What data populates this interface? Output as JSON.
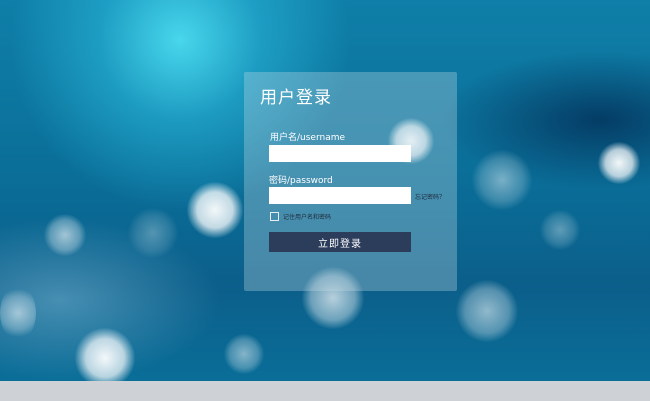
{
  "login": {
    "title": "用户登录",
    "username_label": "用户名/username",
    "username_value": "",
    "password_label": "密码/password",
    "password_value": "",
    "forgot_password": "忘记密码？",
    "remember_me": "记住用户名和密码",
    "remember_checked": false,
    "submit_label": "立即登录"
  },
  "colors": {
    "background": "#0a6f99",
    "panel": "#8fb3c5",
    "submit_button": "#2c3d5b",
    "footer_bar": "#ced2d7"
  }
}
